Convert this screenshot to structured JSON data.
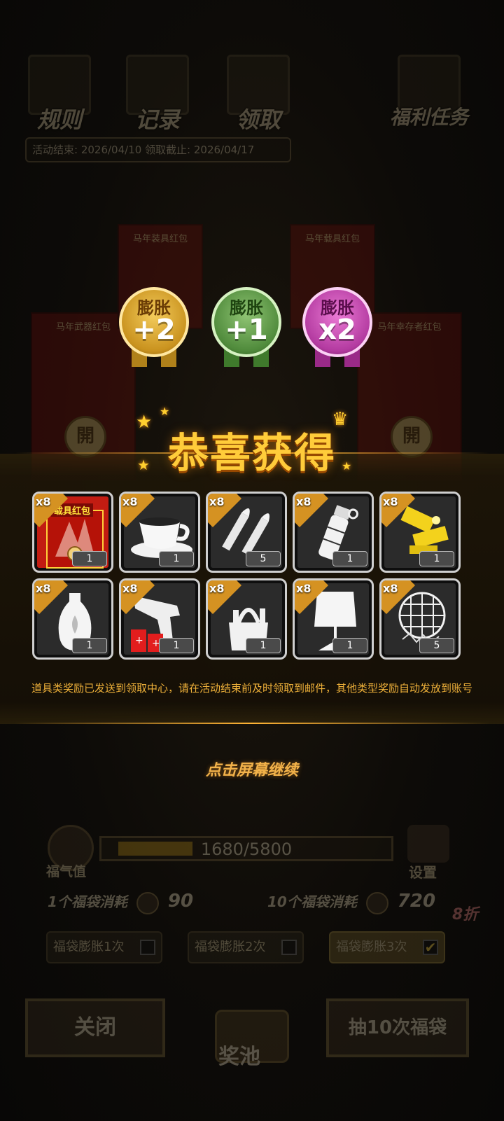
{
  "top_bar": {
    "rules_label": "规则",
    "records_label": "记录",
    "claim_label": "领取",
    "welfare_label": "福利任务",
    "event_dates": "活动结束: 2026/04/10  领取截止: 2026/04/17"
  },
  "background_envelopes": [
    {
      "title": "马年武器红包",
      "seal": "開"
    },
    {
      "title": "马年装具红包",
      "seal": ""
    },
    {
      "title": "马年载具红包",
      "seal": ""
    },
    {
      "title": "马年幸存者红包",
      "seal": "開"
    }
  ],
  "medals": [
    {
      "title": "膨胀",
      "value": "+2",
      "color": "gold"
    },
    {
      "title": "膨胀",
      "value": "+1",
      "color": "green"
    },
    {
      "title": "膨胀",
      "value": "x2",
      "color": "purple"
    }
  ],
  "reward_title": "恭喜获得",
  "items": [
    {
      "name": "载具红包",
      "multiplier": "x8",
      "qty": "1",
      "tag": "载具红包",
      "icon": "red-envelope-icon"
    },
    {
      "name": "coffee-cup",
      "multiplier": "x8",
      "qty": "1",
      "icon": "coffee-cup-icon"
    },
    {
      "name": "bullets",
      "multiplier": "x8",
      "qty": "5",
      "icon": "bullets-icon"
    },
    {
      "name": "grenade",
      "multiplier": "x8",
      "qty": "1",
      "icon": "grenade-icon"
    },
    {
      "name": "gold-parts",
      "multiplier": "x8",
      "qty": "1",
      "icon": "gold-parts-icon"
    },
    {
      "name": "vase",
      "multiplier": "x8",
      "qty": "1",
      "icon": "vase-icon"
    },
    {
      "name": "flare-gun",
      "multiplier": "x8",
      "qty": "1",
      "icon": "flare-gun-icon"
    },
    {
      "name": "toolkit",
      "multiplier": "x8",
      "qty": "1",
      "icon": "toolkit-icon"
    },
    {
      "name": "lamp",
      "multiplier": "x8",
      "qty": "1",
      "icon": "lamp-icon"
    },
    {
      "name": "net",
      "multiplier": "x8",
      "qty": "5",
      "icon": "net-icon"
    }
  ],
  "notice": "道具类奖励已发送到领取中心，请在活动结束前及时领取到邮件，其他类型奖励自动发放到账号",
  "continue_text": "点击屏幕继续",
  "luck": {
    "label": "福气值",
    "progress_text": "1680/5800",
    "progress": 0.2897
  },
  "settings_label": "设置",
  "costs": {
    "single_label": "1个福袋消耗",
    "single_value": "90",
    "ten_label": "10个福袋消耗",
    "ten_value": "720",
    "discount": "8折"
  },
  "options": [
    {
      "label": "福袋膨胀1次",
      "checked": false
    },
    {
      "label": "福袋膨胀2次",
      "checked": false
    },
    {
      "label": "福袋膨胀3次",
      "checked": true
    }
  ],
  "buttons": {
    "close": "关闭",
    "pool": "奖池",
    "draw10": "抽10次福袋"
  },
  "colors": {
    "title": "#ffcc3a",
    "notice": "#f0b23a",
    "accent": "#d59222"
  }
}
